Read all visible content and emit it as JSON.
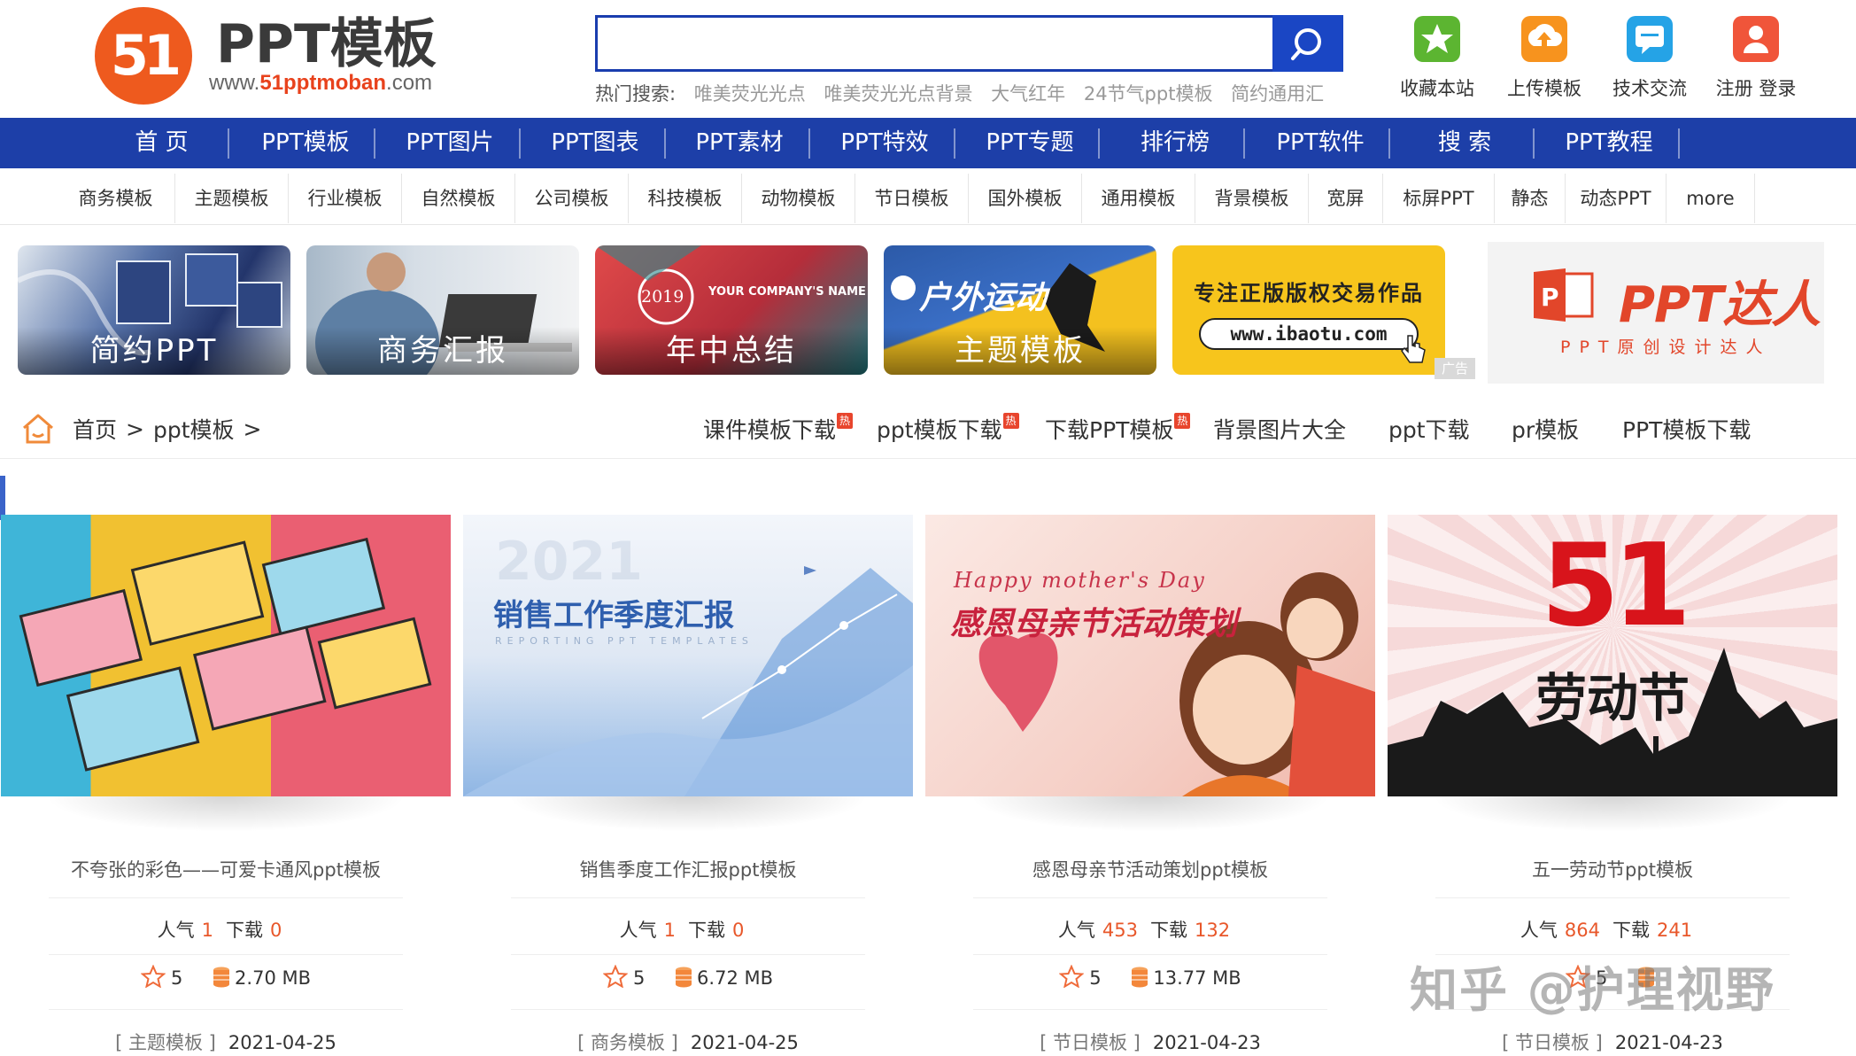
{
  "logo": {
    "badge": "51",
    "title": "PPT模板",
    "url_prefix": "www.",
    "url_brand": "51pptmoban",
    "url_suffix": ".com"
  },
  "search": {
    "value": "",
    "placeholder": "",
    "hot_label": "热门搜索:",
    "hot_keywords": [
      "唯美荧光光点",
      "唯美荧光光点背景",
      "大气红年",
      "24节气ppt模板",
      "简约通用汇"
    ]
  },
  "tools": [
    {
      "label": "收藏本站",
      "icon": "star-icon",
      "color": "#5cb531"
    },
    {
      "label": "上传模板",
      "icon": "upload-icon",
      "color": "#f7931e"
    },
    {
      "label": "技术交流",
      "icon": "chat-icon",
      "color": "#25a3e6"
    },
    {
      "label": "注册 登录",
      "icon": "user-icon",
      "color": "#f0553a"
    }
  ],
  "main_nav": [
    "首 页",
    "PPT模板",
    "PPT图片",
    "PPT图表",
    "PPT素材",
    "PPT特效",
    "PPT专题",
    "排行榜",
    "PPT软件",
    "搜 索",
    "PPT教程"
  ],
  "sub_nav": [
    "商务模板",
    "主题模板",
    "行业模板",
    "自然模板",
    "公司模板",
    "科技模板",
    "动物模板",
    "节日模板",
    "国外模板",
    "通用模板",
    "背景模板",
    "宽屏",
    "标屏PPT",
    "静态",
    "动态PPT",
    "more"
  ],
  "banners": [
    {
      "caption": "简约PPT"
    },
    {
      "caption": "商务汇报"
    },
    {
      "caption": "年中总结",
      "year": "2019",
      "company": "YOUR COMPANY'S NAME"
    },
    {
      "caption": "主题模板",
      "overlay": "户外运动"
    },
    {
      "headline": "专注正版版权交易作品",
      "url": "www.ibaotu.com",
      "ad_label": "广告"
    },
    {
      "brand": "PPT达人",
      "sub": "PPT原创设计达人"
    }
  ],
  "breadcrumb": {
    "home": "首页",
    "sep1": ">",
    "section": "ppt模板",
    "sep2": ">"
  },
  "hot_links": [
    {
      "label": "课件模板下载",
      "hot": true
    },
    {
      "label": "ppt模板下载",
      "hot": true
    },
    {
      "label": "下载PPT模板",
      "hot": true
    },
    {
      "label": "背景图片大全",
      "hot": false
    },
    {
      "label": "ppt下载",
      "hot": false
    },
    {
      "label": "pr模板",
      "hot": false
    },
    {
      "label": "PPT模板下载",
      "hot": false
    }
  ],
  "hot_mark": "热",
  "labels": {
    "popularity": "人气",
    "downloads": "下载"
  },
  "cards": [
    {
      "title": "不夸张的彩色——可爱卡通风ppt模板",
      "popularity": "1",
      "downloads": "0",
      "rating": "5",
      "size": "2.70 MB",
      "category": "[ 主题模板 ]",
      "date": "2021-04-25"
    },
    {
      "title": "销售季度工作汇报ppt模板",
      "popularity": "1",
      "downloads": "0",
      "rating": "5",
      "size": "6.72 MB",
      "category": "[ 商务模板 ]",
      "date": "2021-04-25",
      "thumb_text": "销售工作季度汇报",
      "thumb_sub": "REPORTING PPT TEMPLATES",
      "thumb_year": "2021"
    },
    {
      "title": "感恩母亲节活动策划ppt模板",
      "popularity": "453",
      "downloads": "132",
      "rating": "5",
      "size": "13.77 MB",
      "category": "[ 节日模板 ]",
      "date": "2021-04-23",
      "thumb_script": "Happy mother's Day",
      "thumb_text": "感恩母亲节活动策划"
    },
    {
      "title": "五一劳动节ppt模板",
      "popularity": "864",
      "downloads": "241",
      "rating": "5",
      "size": "",
      "category": "[ 节日模板 ]",
      "date": "2021-04-23",
      "thumb_big": "51",
      "thumb_text": "劳动节"
    }
  ],
  "watermark": "知乎 @护理视野",
  "colors": {
    "nav_blue": "#1d3fa8",
    "accent_orange": "#e8572a",
    "logo_orange": "#ee5a1e"
  }
}
